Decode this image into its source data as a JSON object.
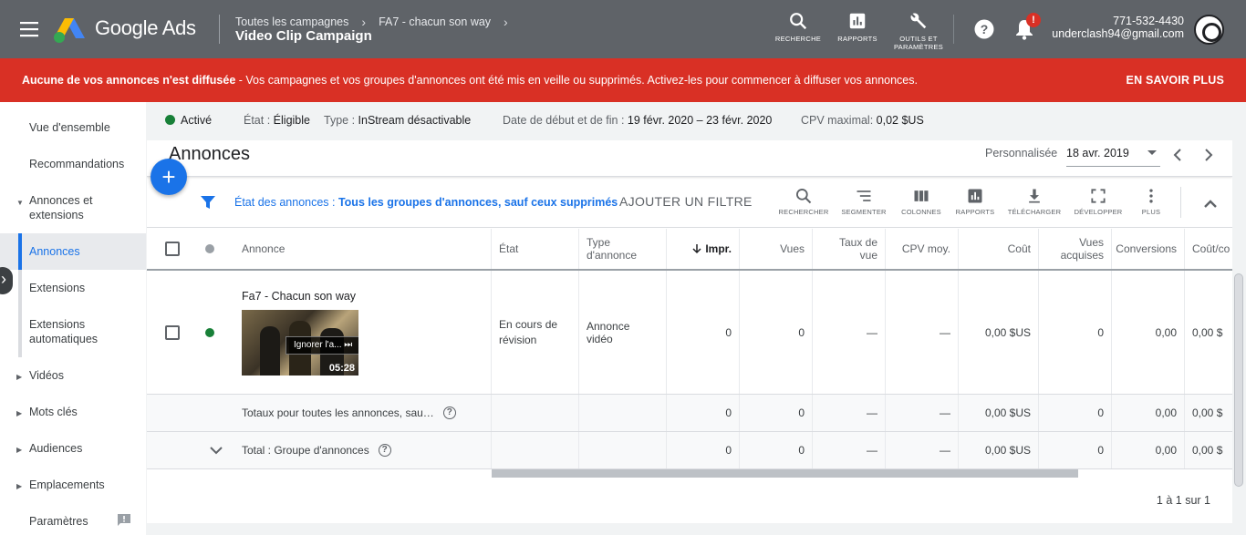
{
  "header": {
    "brand": "Google Ads",
    "breadcrumb": [
      "Toutes les campagnes",
      "FA7 - chacun son way"
    ],
    "campaign_title": "Video Clip Campaign",
    "tools": [
      {
        "label": "RECHERCHE",
        "icon": "search-icon"
      },
      {
        "label": "RAPPORTS",
        "icon": "reports-icon"
      },
      {
        "label": "OUTILS ET PARAMÈTRES",
        "icon": "wrench-icon"
      }
    ],
    "notification_badge": "!",
    "account_phone": "771-532-4430",
    "account_email": "underclash94@gmail.com"
  },
  "alert": {
    "bold": "Aucune de vos annonces n'est diffusée",
    "text": " - Vos campagnes et vos groupes d'annonces ont été mis en veille ou supprimés. Activez-les pour commencer à diffuser vos annonces.",
    "action": "EN SAVOIR PLUS"
  },
  "sidebar": {
    "items": [
      {
        "label": "Vue d'ensemble"
      },
      {
        "label": "Recommandations"
      },
      {
        "label": "Annonces et extensions"
      },
      {
        "label": "Annonces"
      },
      {
        "label": "Extensions"
      },
      {
        "label": "Extensions automatiques"
      },
      {
        "label": "Vidéos"
      },
      {
        "label": "Mots clés"
      },
      {
        "label": "Audiences"
      },
      {
        "label": "Emplacements"
      },
      {
        "label": "Paramètres"
      }
    ]
  },
  "statusbar": {
    "status": "Activé",
    "etat_label": "État :",
    "etat_value": "Éligible",
    "type_label": "Type :",
    "type_value": "InStream désactivable",
    "dates_label": "Date de début et de fin :",
    "dates_value": "19 févr. 2020 – 23 févr. 2020",
    "cpv_label": "CPV maximal:",
    "cpv_value": "0,02 $US"
  },
  "page": {
    "title": "Annonces",
    "date_range_label": "Personnalisée",
    "date_range_value": "18 avr. 2019"
  },
  "filter": {
    "label": "État des annonces : ",
    "value": "Tous les groupes d'annonces, sauf ceux supprimés",
    "add": "AJOUTER UN FILTRE"
  },
  "table_tools": [
    {
      "label": "RECHERCHER"
    },
    {
      "label": "SEGMENTER"
    },
    {
      "label": "COLONNES"
    },
    {
      "label": "RAPPORTS"
    },
    {
      "label": "TÉLÉCHARGER"
    },
    {
      "label": "DÉVELOPPER"
    },
    {
      "label": "PLUS"
    }
  ],
  "table": {
    "columns": [
      "Annonce",
      "État",
      "Type d'annonce",
      "Impr.",
      "Vues",
      "Taux de vue",
      "CPV moy.",
      "Coût",
      "Vues acquises",
      "Conversions",
      "Coût/co"
    ],
    "row": {
      "ad_name": "Fa7 - Chacun son way",
      "skip_label": "Ignorer l'a...",
      "duration": "05:28",
      "state": "En cours de révision",
      "type": "Annonce vidéo",
      "values": [
        "0",
        "0",
        "—",
        "—",
        "0,00 $US",
        "0",
        "0,00",
        "0,00 $"
      ]
    },
    "totals_all": {
      "label": "Totaux pour toutes les annonces, sau…",
      "values": [
        "0",
        "0",
        "—",
        "—",
        "0,00 $US",
        "0",
        "0,00",
        "0,00 $"
      ]
    },
    "totals_group": {
      "label": "Total : Groupe d'annonces",
      "values": [
        "0",
        "0",
        "—",
        "—",
        "0,00 $US",
        "0",
        "0,00",
        "0,00 $"
      ]
    }
  },
  "pager": "1 à 1 sur 1"
}
